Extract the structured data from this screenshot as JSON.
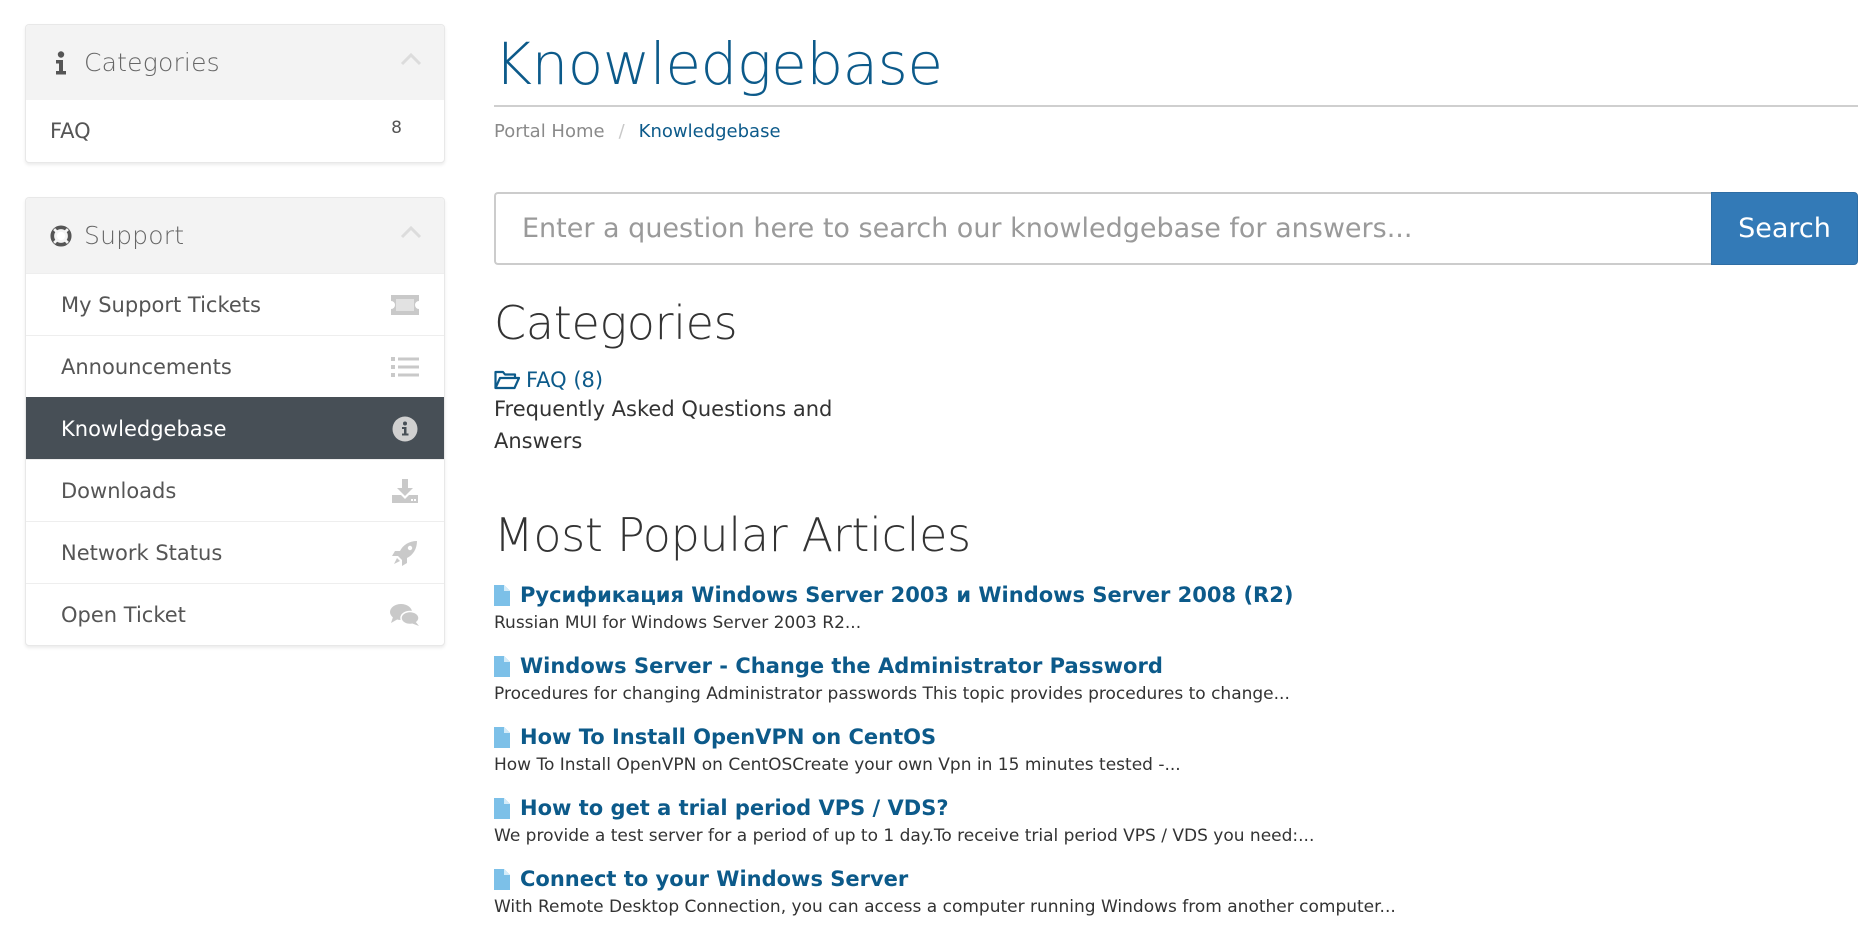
{
  "sidebar": {
    "categories_panel": {
      "title": "Categories",
      "icon": "info-icon",
      "items": [
        {
          "label": "FAQ",
          "count": "8"
        }
      ]
    },
    "support_panel": {
      "title": "Support",
      "icon": "life-ring-icon",
      "items": [
        {
          "label": "My Support Tickets",
          "icon": "ticket-icon",
          "active": false
        },
        {
          "label": "Announcements",
          "icon": "list-icon",
          "active": false
        },
        {
          "label": "Knowledgebase",
          "icon": "info-circle-icon",
          "active": true
        },
        {
          "label": "Downloads",
          "icon": "download-icon",
          "active": false
        },
        {
          "label": "Network Status",
          "icon": "rocket-icon",
          "active": false
        },
        {
          "label": "Open Ticket",
          "icon": "comments-icon",
          "active": false
        }
      ]
    }
  },
  "main": {
    "title": "Knowledgebase",
    "breadcrumb": {
      "home": "Portal Home",
      "separator": "/",
      "current": "Knowledgebase"
    },
    "search": {
      "placeholder": "Enter a question here to search our knowledgebase for answers...",
      "value": "",
      "button_label": "Search"
    },
    "categories": {
      "heading": "Categories",
      "items": [
        {
          "label": "FAQ (8)",
          "icon": "folder-open-icon",
          "description": "Frequently Asked Questions and Answers"
        }
      ]
    },
    "popular": {
      "heading": "Most Popular Articles",
      "articles": [
        {
          "title": "Русификация Windows Server 2003 и Windows Server 2008 (R2)",
          "snippet": "Russian MUI for Windows Server 2003 R2..."
        },
        {
          "title": "Windows Server - Change the Administrator Password",
          "snippet": "Procedures for changing Administrator passwords This topic provides procedures to change..."
        },
        {
          "title": "How To Install OpenVPN on CentOS",
          "snippet": "How To Install OpenVPN on CentOSCreate your own Vpn in 15 minutes tested -..."
        },
        {
          "title": "How to get a trial period VPS / VDS?",
          "snippet": "We provide a test server for a period of up to 1 day.To receive trial period VPS / VDS you need:..."
        },
        {
          "title": "Connect to your Windows Server",
          "snippet": "With Remote Desktop Connection, you can access a computer running Windows from another computer..."
        }
      ]
    }
  },
  "colors": {
    "brand_link": "#0c5a8a",
    "primary_button": "#337ab7",
    "active_nav": "#474f56",
    "panel_header": "#f3f3f3",
    "article_icon": "#7cc0e8",
    "muted_icon": "#c9c9c9"
  }
}
